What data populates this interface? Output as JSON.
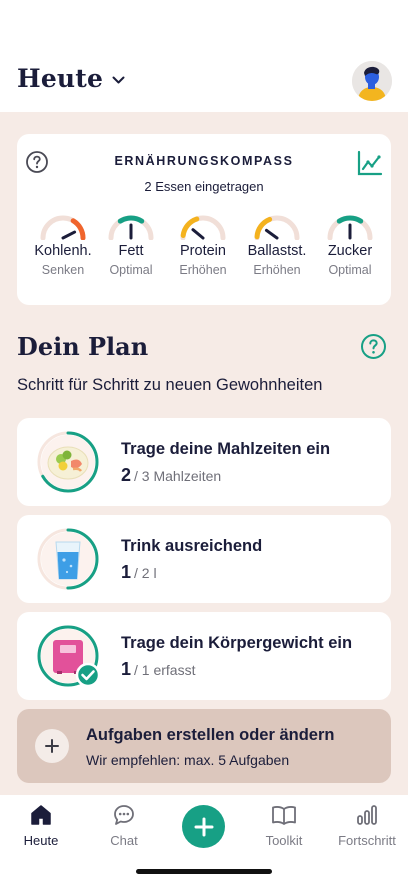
{
  "header": {
    "title": "Heute"
  },
  "compass": {
    "title": "ERNÄHRUNGSKOMPASS",
    "subtitle": "2 Essen eingetragen",
    "gauges": [
      {
        "name": "Kohlenh.",
        "status": "Senken",
        "level": 0.85,
        "color": "#f0652d"
      },
      {
        "name": "Fett",
        "status": "Optimal",
        "level": 0.5,
        "color": "#17a085"
      },
      {
        "name": "Protein",
        "status": "Erhöhen",
        "level": 0.22,
        "color": "#f4b21e"
      },
      {
        "name": "Ballastst.",
        "status": "Erhöhen",
        "level": 0.2,
        "color": "#f4b21e"
      },
      {
        "name": "Zucker",
        "status": "Optimal",
        "level": 0.5,
        "color": "#17a085"
      }
    ]
  },
  "plan": {
    "title": "Dein Plan",
    "subtitle": "Schritt für Schritt zu neuen Gewohnheiten",
    "tasks": [
      {
        "title": "Trage deine Mahlzeiten ein",
        "count": "2",
        "total": "/ 3 Mahlzeiten",
        "progress": 0.667,
        "icon": "meal-plate-icon"
      },
      {
        "title": "Trink ausreichend",
        "count": "1",
        "total": "/ 2 l",
        "progress": 0.5,
        "icon": "water-glass-icon"
      },
      {
        "title": "Trage dein Körpergewicht ein",
        "count": "1",
        "total": "/ 1 erfasst",
        "progress": 1.0,
        "icon": "scale-icon"
      }
    ]
  },
  "edit": {
    "title": "Aufgaben erstellen oder ändern",
    "subtitle": "Wir empfehlen: max. 5 Aufgaben"
  },
  "tabs": [
    {
      "label": "Heute",
      "icon": "home-icon",
      "active": true
    },
    {
      "label": "Chat",
      "icon": "chat-icon",
      "active": false
    },
    {
      "label": "Toolkit",
      "icon": "book-icon",
      "active": false
    },
    {
      "label": "Fortschritt",
      "icon": "bar-chart-icon",
      "active": false
    }
  ],
  "colors": {
    "accent": "#17a085",
    "background": "#f6ebe6",
    "text": "#1b1d3a",
    "edit_bg": "#dcc7bd"
  }
}
